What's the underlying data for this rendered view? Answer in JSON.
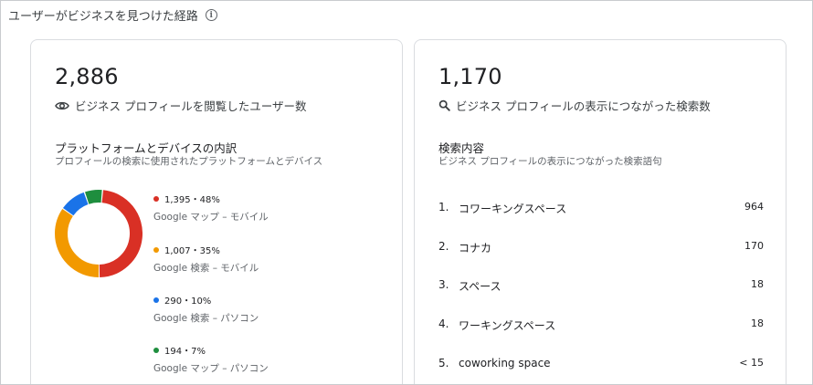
{
  "header": {
    "title": "ユーザーがビジネスを見つけた経路"
  },
  "views_card": {
    "total": "2,886",
    "label": "ビジネス プロフィールを閲覧したユーザー数",
    "breakdown_title": "プラットフォームとデバイスの内訳",
    "breakdown_subtitle": "プロフィールの検索に使用されたプラットフォームとデバイス",
    "segments": [
      {
        "value_text": "1,395・48%",
        "label": "Google マップ – モバイル",
        "value": 1395,
        "percent": 48,
        "color": "#d93025"
      },
      {
        "value_text": "1,007・35%",
        "label": "Google 検索 – モバイル",
        "value": 1007,
        "percent": 35,
        "color": "#f29900"
      },
      {
        "value_text": "290・10%",
        "label": "Google 検索 – パソコン",
        "value": 290,
        "percent": 10,
        "color": "#1a73e8"
      },
      {
        "value_text": "194・7%",
        "label": "Google マップ – パソコン",
        "value": 194,
        "percent": 7,
        "color": "#1e8e3e"
      }
    ]
  },
  "search_card": {
    "total": "1,170",
    "label": "ビジネス プロフィールの表示につながった検索数",
    "terms_title": "検索内容",
    "terms_subtitle": "ビジネス プロフィールの表示につながった検索語句",
    "terms": [
      {
        "rank": "1.",
        "term": "コワーキングスペース",
        "count": "964"
      },
      {
        "rank": "2.",
        "term": "コナカ",
        "count": "170"
      },
      {
        "rank": "3.",
        "term": "スペース",
        "count": "18"
      },
      {
        "rank": "4.",
        "term": "ワーキングスペース",
        "count": "18"
      },
      {
        "rank": "5.",
        "term": "coworking space",
        "count": "< 15"
      }
    ]
  },
  "icons": {
    "info": "info-icon",
    "eye": "eye-icon",
    "search": "search-icon"
  }
}
